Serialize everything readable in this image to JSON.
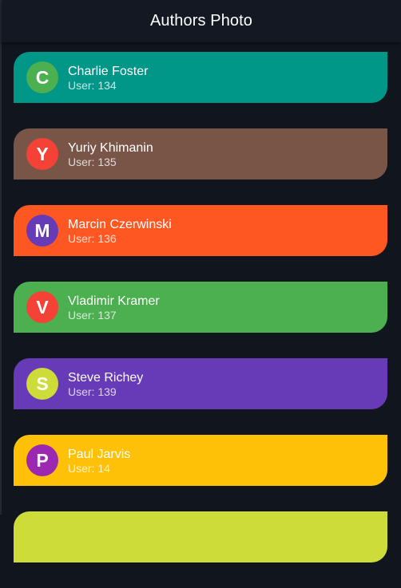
{
  "appbar": {
    "title": "Authors Photo"
  },
  "authors": [
    {
      "initial": "C",
      "name": "Charlie Foster",
      "user": "User: 134",
      "card_color": "#009688",
      "avatar_color": "#4caf50"
    },
    {
      "initial": "Y",
      "name": "Yuriy Khimanin",
      "user": "User: 135",
      "card_color": "#795548",
      "avatar_color": "#f44336"
    },
    {
      "initial": "M",
      "name": "Marcin Czerwinski",
      "user": "User: 136",
      "card_color": "#ff5722",
      "avatar_color": "#673ab7"
    },
    {
      "initial": "V",
      "name": "Vladimir Kramer",
      "user": "User: 137",
      "card_color": "#4caf50",
      "avatar_color": "#f44336"
    },
    {
      "initial": "S",
      "name": "Steve Richey",
      "user": "User: 139",
      "card_color": "#673ab7",
      "avatar_color": "#cddc39"
    },
    {
      "initial": "P",
      "name": "Paul Jarvis",
      "user": "User: 14",
      "card_color": "#ffc107",
      "avatar_color": "#9c27b0"
    },
    {
      "initial": "",
      "name": "",
      "user": "",
      "card_color": "#cddc39",
      "avatar_color": "#cddc39"
    }
  ]
}
